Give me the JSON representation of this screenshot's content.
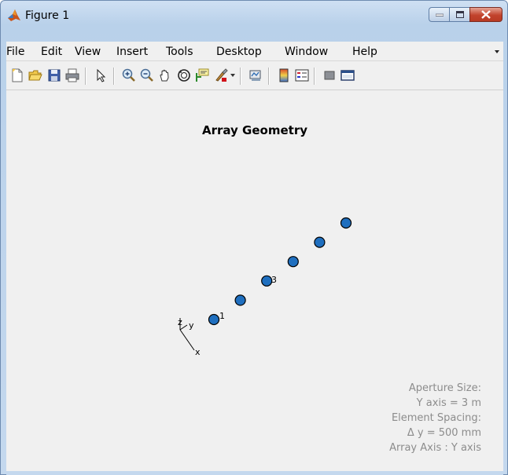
{
  "window": {
    "title": "Figure 1"
  },
  "menu": {
    "items": [
      {
        "label": "File"
      },
      {
        "label": "Edit"
      },
      {
        "label": "View"
      },
      {
        "label": "Insert"
      },
      {
        "label": "Tools"
      },
      {
        "label": "Desktop"
      },
      {
        "label": "Window"
      },
      {
        "label": "Help"
      }
    ]
  },
  "toolbar": {
    "icons": [
      "new-figure-icon",
      "open-file-icon",
      "save-icon",
      "print-icon",
      "pointer-icon",
      "zoom-in-icon",
      "zoom-out-icon",
      "pan-icon",
      "rotate-3d-icon",
      "data-cursor-icon",
      "brush-icon",
      "link-plot-icon",
      "insert-colorbar-icon",
      "insert-legend-icon",
      "hide-plot-tools-icon",
      "show-plot-tools-icon"
    ]
  },
  "plot": {
    "title": "Array Geometry",
    "axes_triad": {
      "z": "z",
      "y": "y",
      "x": "x"
    },
    "element_labels": [
      {
        "element": 1,
        "text": "1"
      },
      {
        "element": 3,
        "text": "3"
      }
    ],
    "info": {
      "line1": "Aperture Size:",
      "line2": "Y axis = 3 m",
      "line3": "Element Spacing:",
      "line4": "Δ y = 500 mm",
      "line5": "Array Axis : Y axis"
    },
    "marker_color": "#1f6fbf"
  },
  "chart_data": {
    "type": "scatter",
    "title": "Array Geometry",
    "series": [
      {
        "x": [
          1,
          2,
          3,
          4,
          5,
          6
        ],
        "y": [
          -1.25,
          -0.75,
          -0.25,
          0.25,
          0.75,
          1.25
        ]
      }
    ],
    "grid": false
  }
}
